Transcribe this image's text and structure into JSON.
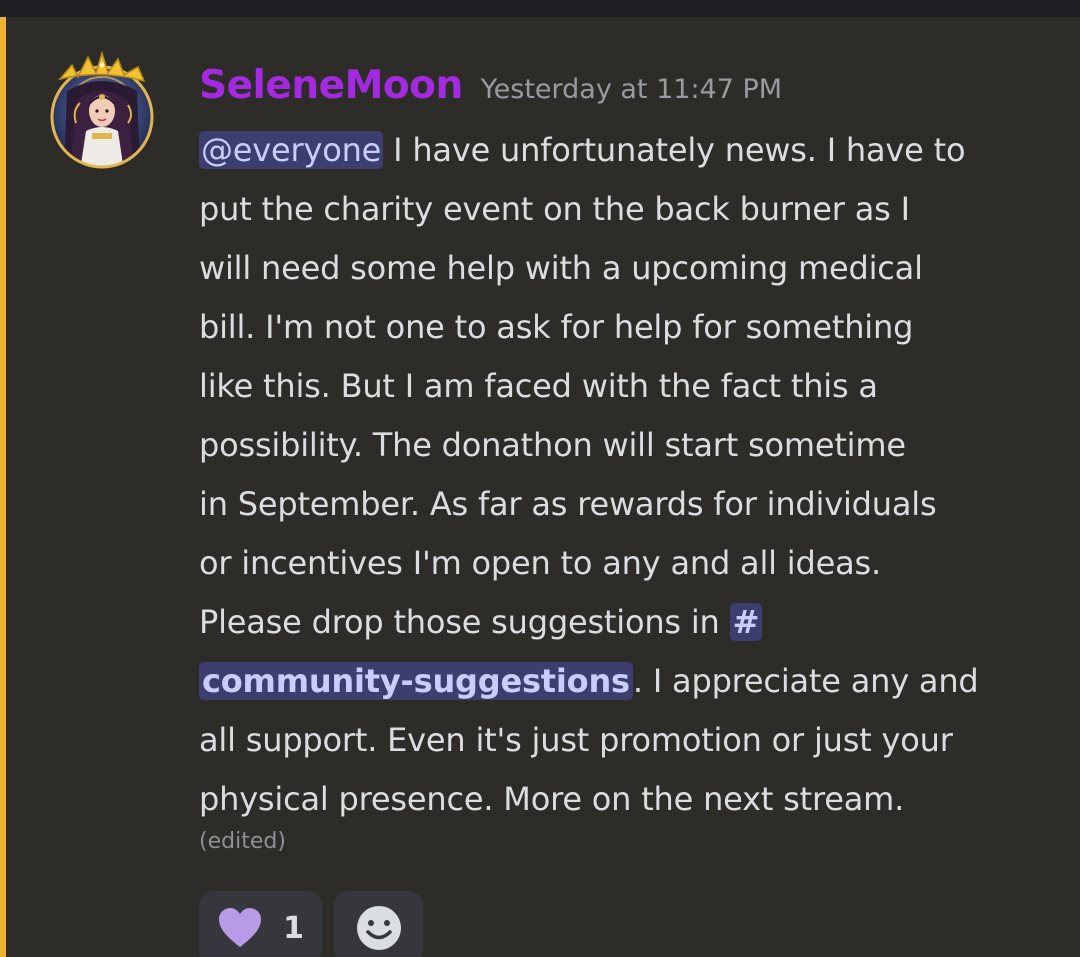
{
  "message": {
    "username": "SeleneMoon",
    "timestamp": "Yesterday at 11:47 PM",
    "mention": "@everyone",
    "lines": [
      " I have unfortunately news. I have to",
      "put the charity event on the back burner as I",
      "will need some help with a upcoming medical",
      "bill. I'm not one to ask for help for something",
      "like this. But I am faced with the fact this a",
      "possibility.  The donathon will start sometime",
      "in September. As far as rewards for individuals",
      "or incentives I'm open to any and all ideas.",
      "Please drop those suggestions in "
    ],
    "channel_hash": "#",
    "channel_name": "community-suggestions",
    "after_channel": ". I appreciate any and",
    "tail_lines": [
      "all support. Even it's just promotion or just your",
      "physical presence. More on the next stream."
    ],
    "edited": "(edited)"
  },
  "reactions": [
    {
      "emoji": "purple-heart-icon",
      "count": "1"
    },
    {
      "emoji": "add-reaction-smiley-icon"
    }
  ],
  "colors": {
    "username": "#a32ae0",
    "mention_stripe": "#f0b232",
    "mention_bg": "#3c3f6e",
    "heart": "#b79be6"
  }
}
